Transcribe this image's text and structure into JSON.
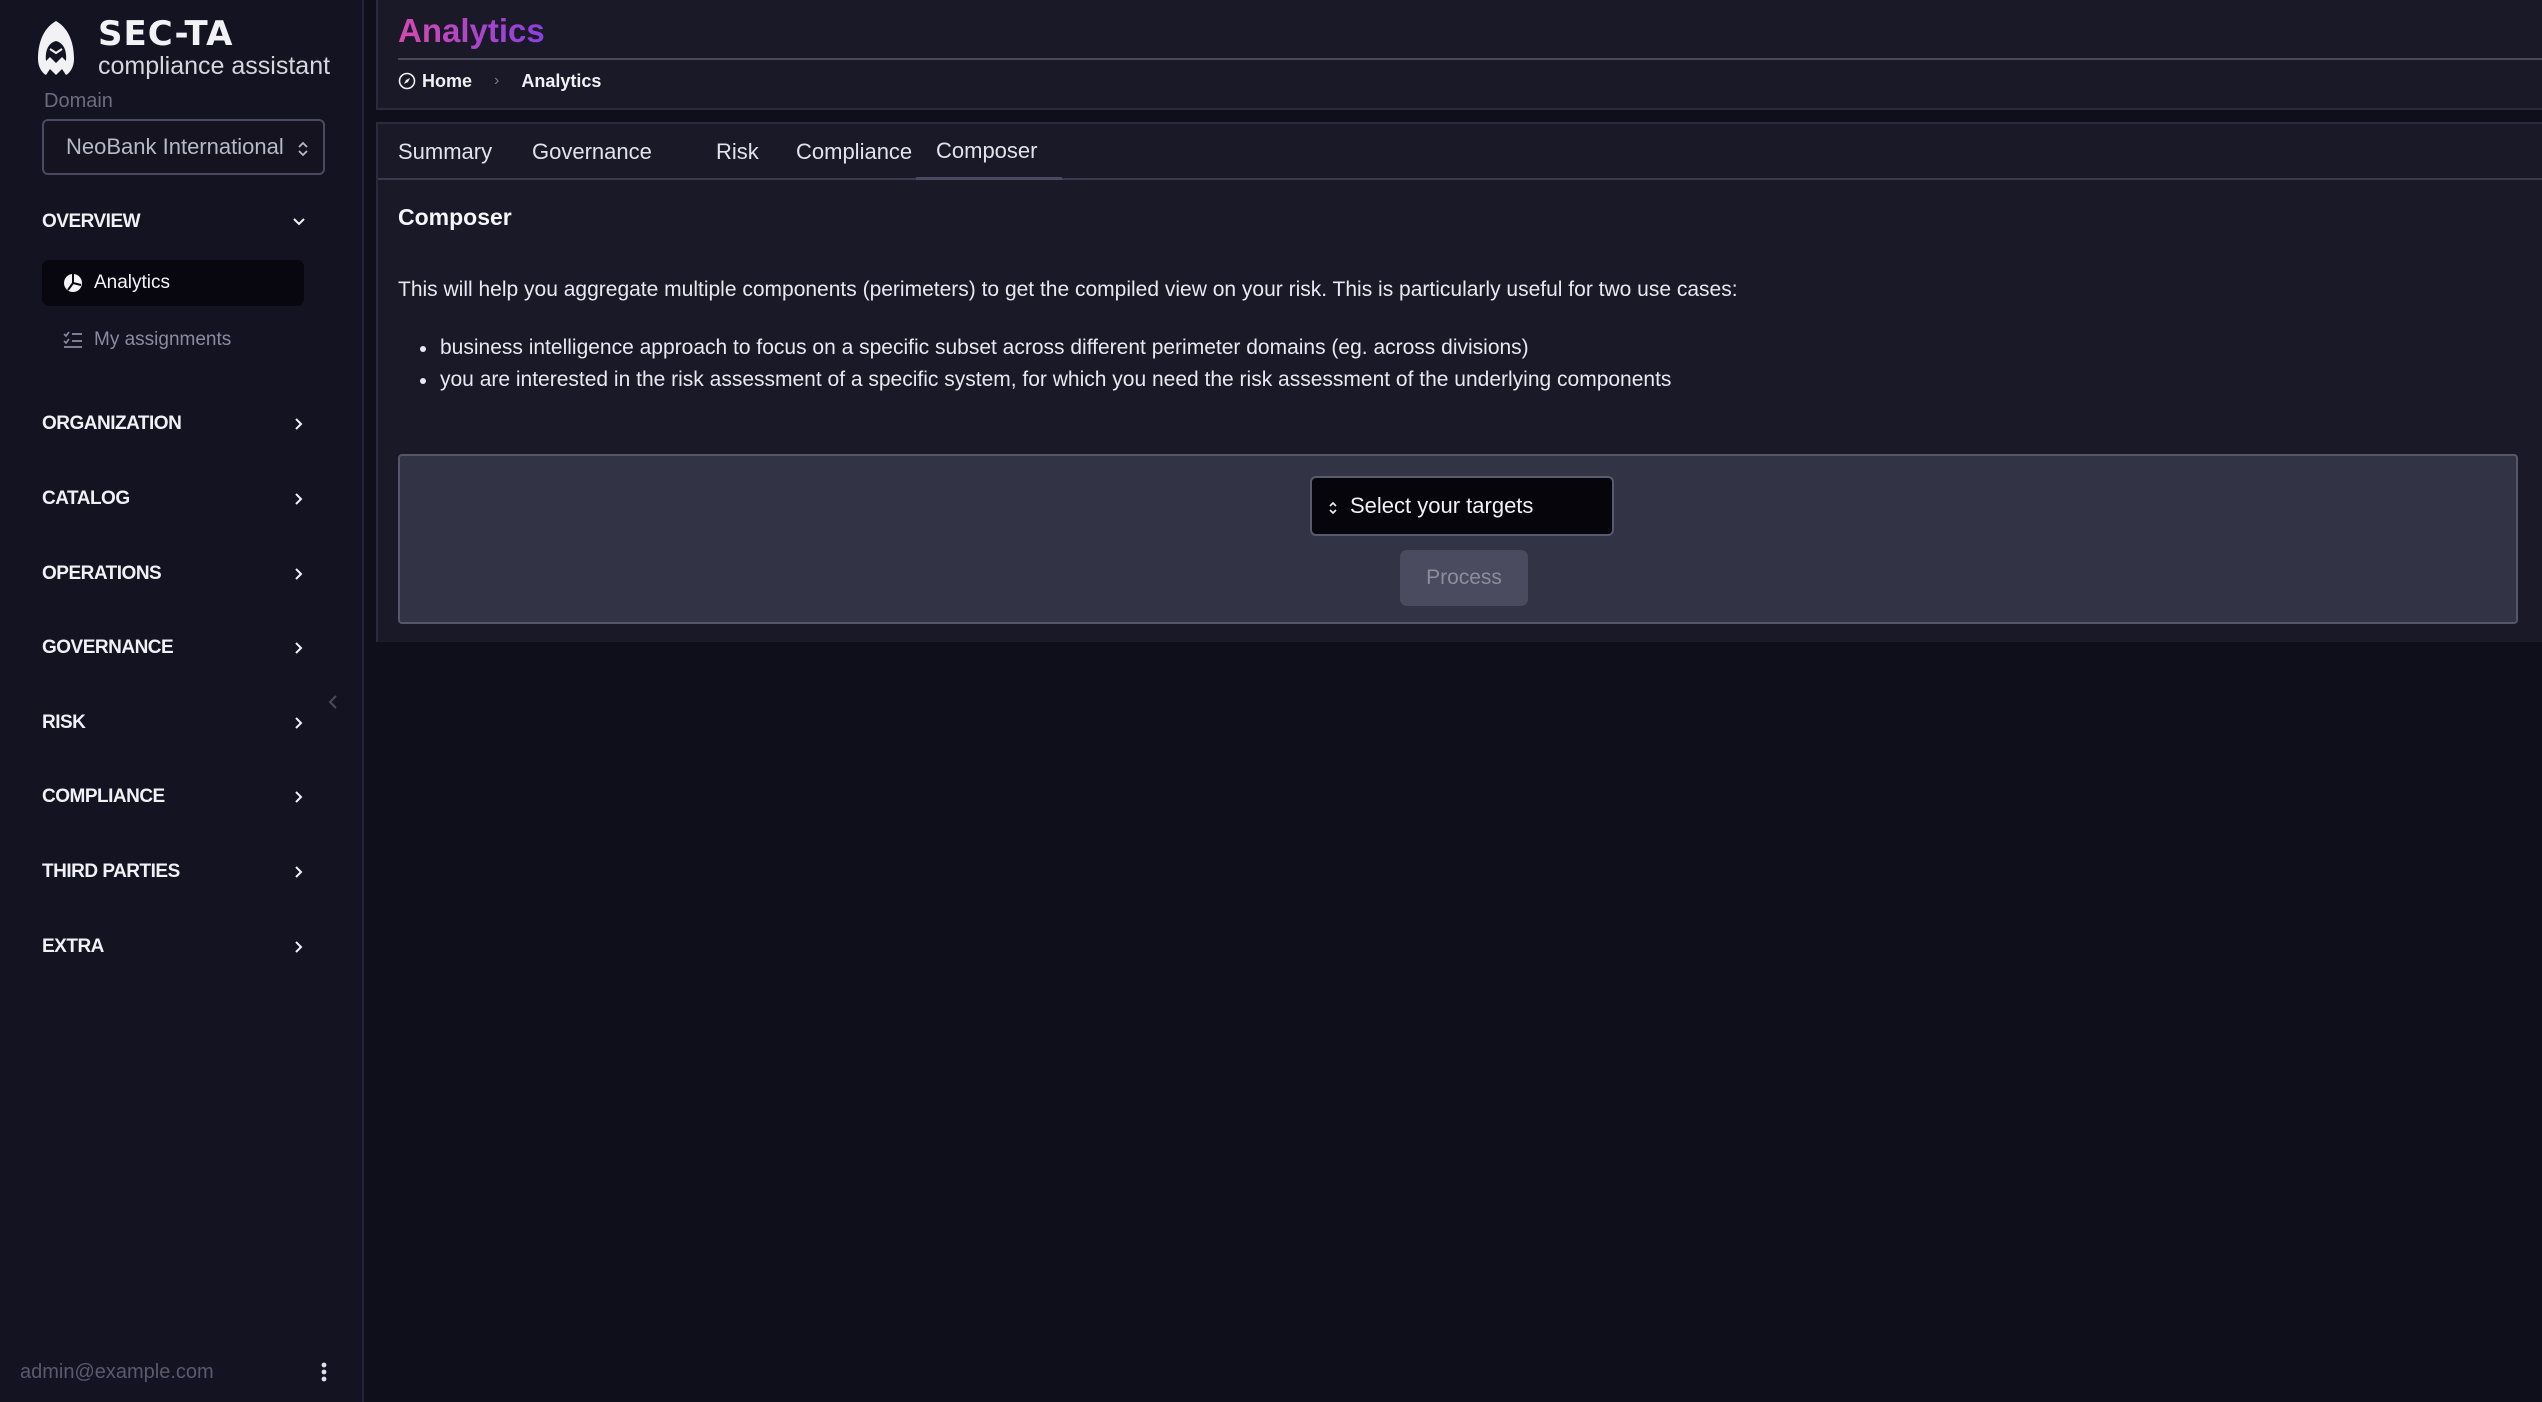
{
  "brand": {
    "name": "SEC-TA",
    "subtitle": "compliance assistant"
  },
  "domain": {
    "label": "Domain",
    "value": "NeoBank International"
  },
  "sidebar": {
    "overview": {
      "label": "OVERVIEW",
      "items": [
        {
          "label": "Analytics",
          "icon": "chart-pie-icon"
        },
        {
          "label": "My assignments",
          "icon": "list-check-icon"
        }
      ]
    },
    "sections": [
      {
        "label": "ORGANIZATION"
      },
      {
        "label": "CATALOG"
      },
      {
        "label": "OPERATIONS"
      },
      {
        "label": "GOVERNANCE"
      },
      {
        "label": "RISK"
      },
      {
        "label": "COMPLIANCE"
      },
      {
        "label": "THIRD PARTIES"
      },
      {
        "label": "EXTRA"
      }
    ],
    "user_email": "admin@example.com"
  },
  "header": {
    "title": "Analytics",
    "breadcrumb": {
      "home": "Home",
      "separator": "›",
      "current": "Analytics"
    }
  },
  "tabs": [
    {
      "label": "Summary"
    },
    {
      "label": "Governance"
    },
    {
      "label": "Risk"
    },
    {
      "label": "Compliance"
    },
    {
      "label": "Composer"
    }
  ],
  "active_tab": "Composer",
  "composer": {
    "heading": "Composer",
    "intro": "This will help you aggregate multiple components (perimeters) to get the compiled view on your risk. This is particularly useful for two use cases:",
    "bullets": [
      "business intelligence approach to focus on a specific subset across different perimeter domains (eg. across divisions)",
      "you are interested in the risk assessment of a specific system, for which you need the risk assessment of the underlying components"
    ],
    "select_placeholder": "Select your targets",
    "process_label": "Process"
  },
  "colors": {
    "background": "#0f0e1b",
    "sidebar": "#141322",
    "title_gradient_start": "#d34ab0",
    "title_gradient_end": "#8b3fe0",
    "composer_box": "#323445"
  }
}
